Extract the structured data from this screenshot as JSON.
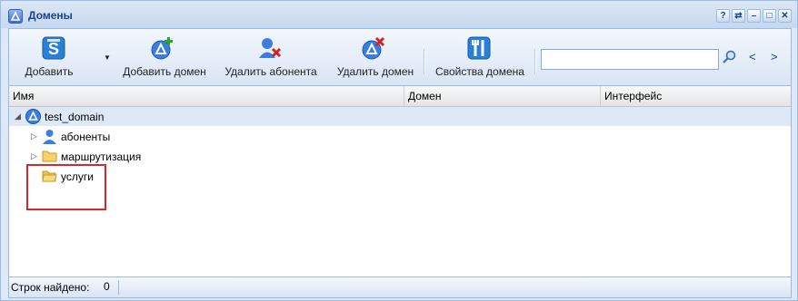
{
  "window": {
    "title": "Домены"
  },
  "title_tools": [
    "?",
    "⇄",
    "–",
    "□",
    "✕"
  ],
  "toolbar": {
    "add_label": "Добавить",
    "add_domain_label": "Добавить домен",
    "delete_subscriber_label": "Удалить абонента",
    "delete_domain_label": "Удалить домен",
    "domain_properties_label": "Свойства домена",
    "search_value": "",
    "prev_label": "<",
    "next_label": ">"
  },
  "grid": {
    "columns": [
      "Имя",
      "Домен",
      "Интерфейс"
    ],
    "rows": [
      {
        "label": "test_domain",
        "icon": "domain-icon",
        "expanded": true
      },
      {
        "label": "абоненты",
        "icon": "user-icon",
        "expanded": false
      },
      {
        "label": "маршрутизация",
        "icon": "folder-icon",
        "expanded": false
      },
      {
        "label": "услуги",
        "icon": "open-folder-icon",
        "expanded": null
      }
    ]
  },
  "status": {
    "found_label": "Строк найдено:",
    "found_count": "0"
  },
  "colors": {
    "accent": "#15428b",
    "border": "#99bbe8",
    "highlight": "#d9252b"
  }
}
